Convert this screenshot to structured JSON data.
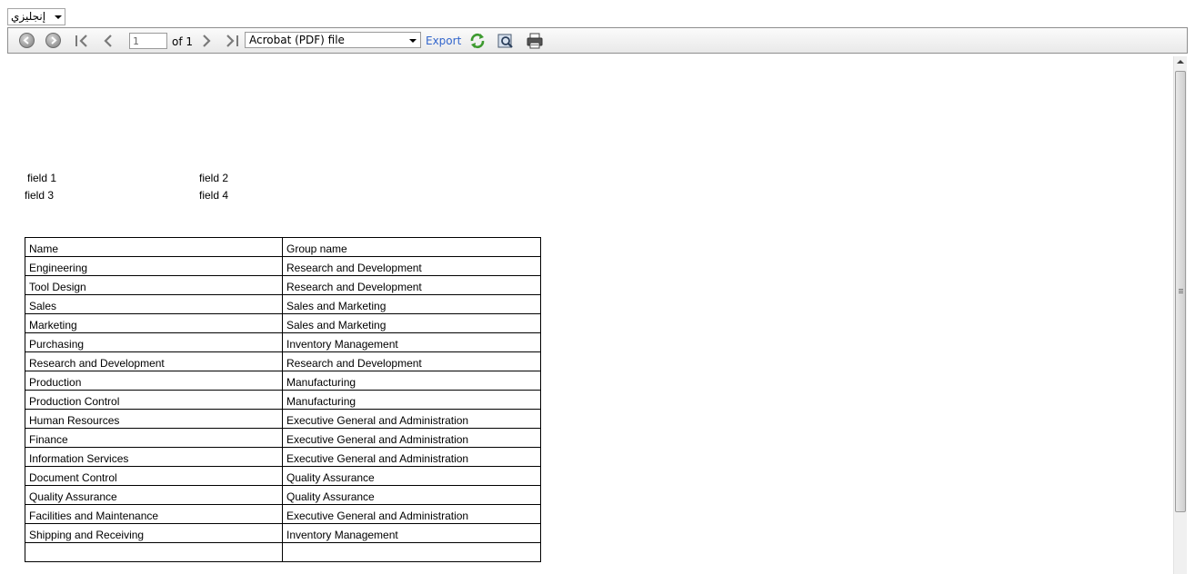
{
  "language_select": {
    "value": "إنجليزي"
  },
  "toolbar": {
    "page_number": "1",
    "page_of": "of 1",
    "export_format": "Acrobat (PDF) file",
    "export_label": "Export",
    "icons": {
      "back": "back-icon",
      "forward": "forward-icon",
      "first": "first-page-icon",
      "previous": "previous-page-icon",
      "next": "next-page-icon",
      "last": "last-page-icon",
      "refresh": "refresh-icon",
      "find": "find-icon",
      "print": "print-icon"
    }
  },
  "report": {
    "fields": {
      "field1": "field 1",
      "field2": "field 2",
      "field3": "field 3",
      "field4": "field 4"
    },
    "table": {
      "headers": [
        "Name",
        "Group name"
      ],
      "rows": [
        [
          "Engineering",
          "Research and Development"
        ],
        [
          "Tool Design",
          "Research and Development"
        ],
        [
          "Sales",
          "Sales and Marketing"
        ],
        [
          "Marketing",
          "Sales and Marketing"
        ],
        [
          "Purchasing",
          "Inventory Management"
        ],
        [
          "Research and Development",
          "Research and Development"
        ],
        [
          "Production",
          "Manufacturing"
        ],
        [
          "Production Control",
          "Manufacturing"
        ],
        [
          "Human Resources",
          "Executive General and Administration"
        ],
        [
          "Finance",
          "Executive General and Administration"
        ],
        [
          "Information Services",
          "Executive General and Administration"
        ],
        [
          "Document Control",
          "Quality Assurance"
        ],
        [
          "Quality Assurance",
          "Quality Assurance"
        ],
        [
          "Facilities and Maintenance",
          "Executive General and Administration"
        ],
        [
          "Shipping and Receiving",
          "Inventory Management"
        ],
        [
          "",
          ""
        ]
      ]
    }
  }
}
